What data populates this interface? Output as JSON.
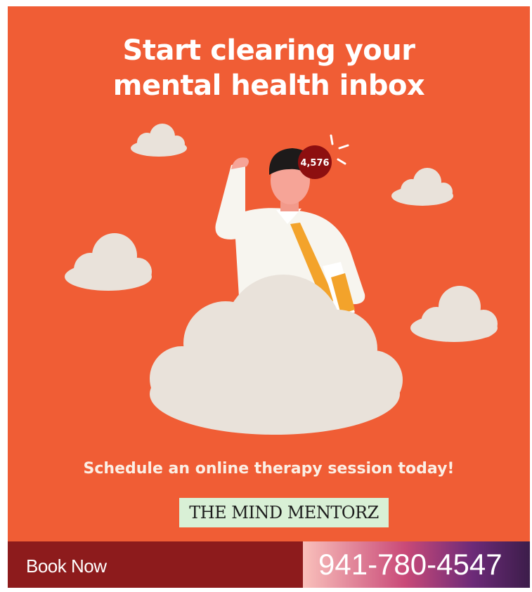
{
  "headline": {
    "line1": "Start clearing your",
    "line2": "mental health inbox"
  },
  "illustration": {
    "badge_count": "4,576"
  },
  "subline": "Schedule an online therapy session today!",
  "brand": "THE MIND MENTORZ",
  "footer": {
    "book_label": "Book Now",
    "phone": "941-780-4547"
  },
  "colors": {
    "background": "#f05d35",
    "cloud": "#e9e2da",
    "badge": "#8d0f10",
    "footer_bar": "#8d1b1c",
    "brand_box": "#d9f0d6"
  },
  "icons": [
    "cloud-icon",
    "person-illustration",
    "notification-badge"
  ]
}
